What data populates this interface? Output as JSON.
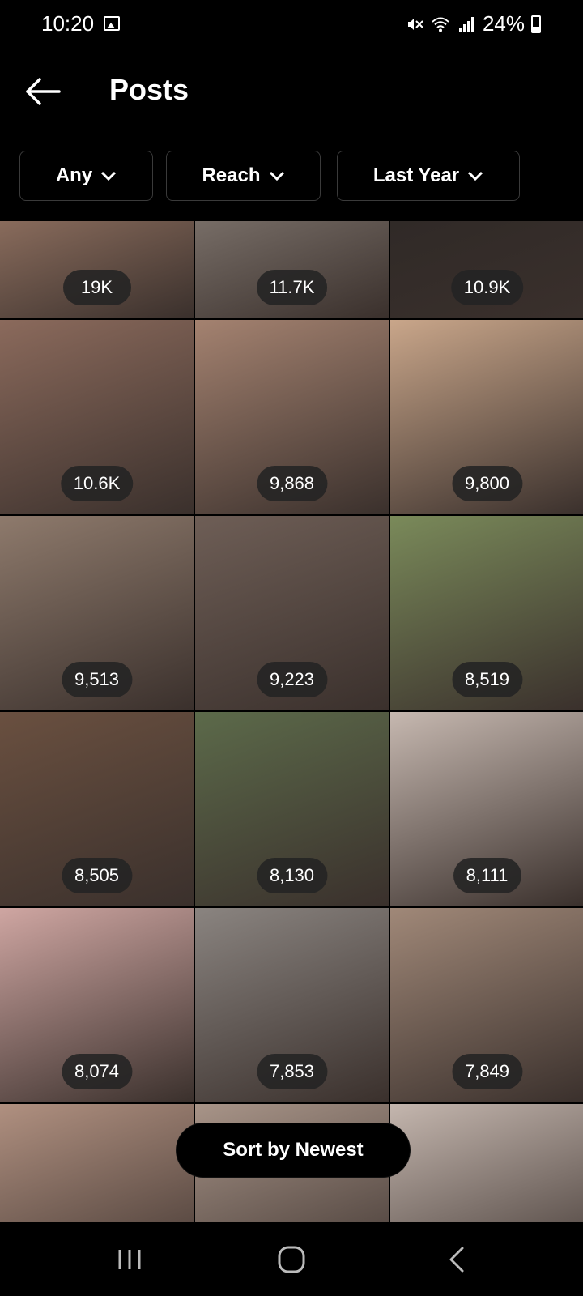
{
  "status_bar": {
    "time": "10:20",
    "battery": "24%",
    "icons": [
      "gallery-icon",
      "mute-icon",
      "wifi-icon",
      "signal-icon",
      "battery-icon"
    ]
  },
  "header": {
    "title": "Posts",
    "back_icon": "back-arrow-icon"
  },
  "filters": [
    {
      "label": "Any"
    },
    {
      "label": "Reach"
    },
    {
      "label": "Last Year"
    }
  ],
  "posts": [
    {
      "reach": "19K",
      "color": "#b78e78"
    },
    {
      "reach": "11.7K",
      "color": "#9a9088"
    },
    {
      "reach": "10.9K",
      "color": "#2a2624"
    },
    {
      "reach": "10.6K",
      "color": "#8b6a5c"
    },
    {
      "reach": "9,868",
      "color": "#a48270"
    },
    {
      "reach": "9,800",
      "color": "#c9a68a"
    },
    {
      "reach": "9,513",
      "color": "#8e7a6c"
    },
    {
      "reach": "9,223",
      "color": "#6e5e56"
    },
    {
      "reach": "8,519",
      "color": "#7a8a5a"
    },
    {
      "reach": "8,505",
      "color": "#6a5040"
    },
    {
      "reach": "8,130",
      "color": "#5c6a4a"
    },
    {
      "reach": "8,111",
      "color": "#c6b8b0"
    },
    {
      "reach": "8,074",
      "color": "#cfa6a2"
    },
    {
      "reach": "7,853",
      "color": "#8a8480"
    },
    {
      "reach": "7,849",
      "color": "#a08878"
    },
    {
      "reach": "",
      "color": "#b09080"
    },
    {
      "reach": "",
      "color": "#a89488"
    },
    {
      "reach": "",
      "color": "#c4b6ae"
    }
  ],
  "sort_button": {
    "label": "Sort by Newest"
  },
  "nav": [
    "recents-icon",
    "home-icon",
    "back-icon"
  ]
}
